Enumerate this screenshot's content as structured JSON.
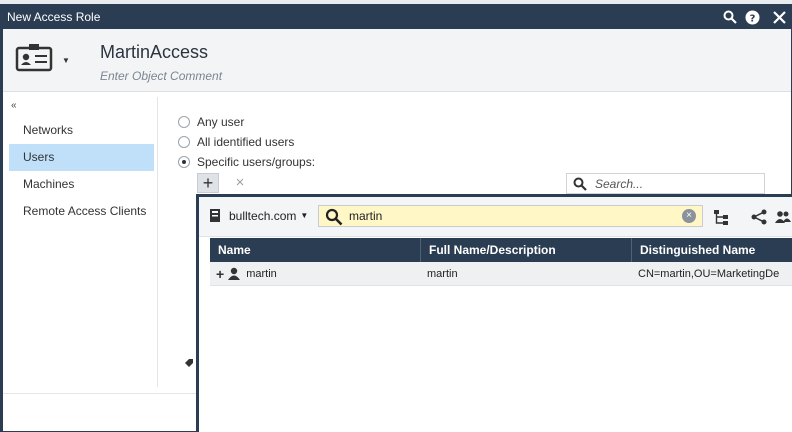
{
  "window": {
    "title": "New Access Role"
  },
  "object": {
    "name": "MartinAccess",
    "comment_placeholder": "Enter Object Comment"
  },
  "nav": {
    "collapse_glyph": "«",
    "items": [
      {
        "label": "Networks"
      },
      {
        "label": "Users"
      },
      {
        "label": "Machines"
      },
      {
        "label": "Remote Access Clients"
      }
    ],
    "active_index": 1
  },
  "users_section": {
    "options": [
      {
        "label": "Any user",
        "checked": false
      },
      {
        "label": "All identified users",
        "checked": false
      },
      {
        "label": "Specific users/groups:",
        "checked": true
      }
    ],
    "add_glyph": "+",
    "remove_glyph": "×",
    "search_placeholder": "Search..."
  },
  "picker": {
    "domain": "bulltech.com",
    "search_value": "martin",
    "clear_glyph": "×",
    "columns": [
      "Name",
      "Full Name/Description",
      "Distinguished Name"
    ],
    "rows": [
      {
        "name": "martin",
        "full_name": "martin",
        "dn": "CN=martin,OU=MarketingDe"
      }
    ]
  },
  "icons": {
    "window_buttons": [
      "search-icon",
      "help-icon",
      "close-icon"
    ],
    "picker_tools": [
      "tree-icon",
      "share-icon",
      "users-icon"
    ]
  },
  "colors": {
    "titlebar": "#2b3d52",
    "nav_active": "#bfe0f8",
    "search_highlight": "#fff7c6"
  }
}
